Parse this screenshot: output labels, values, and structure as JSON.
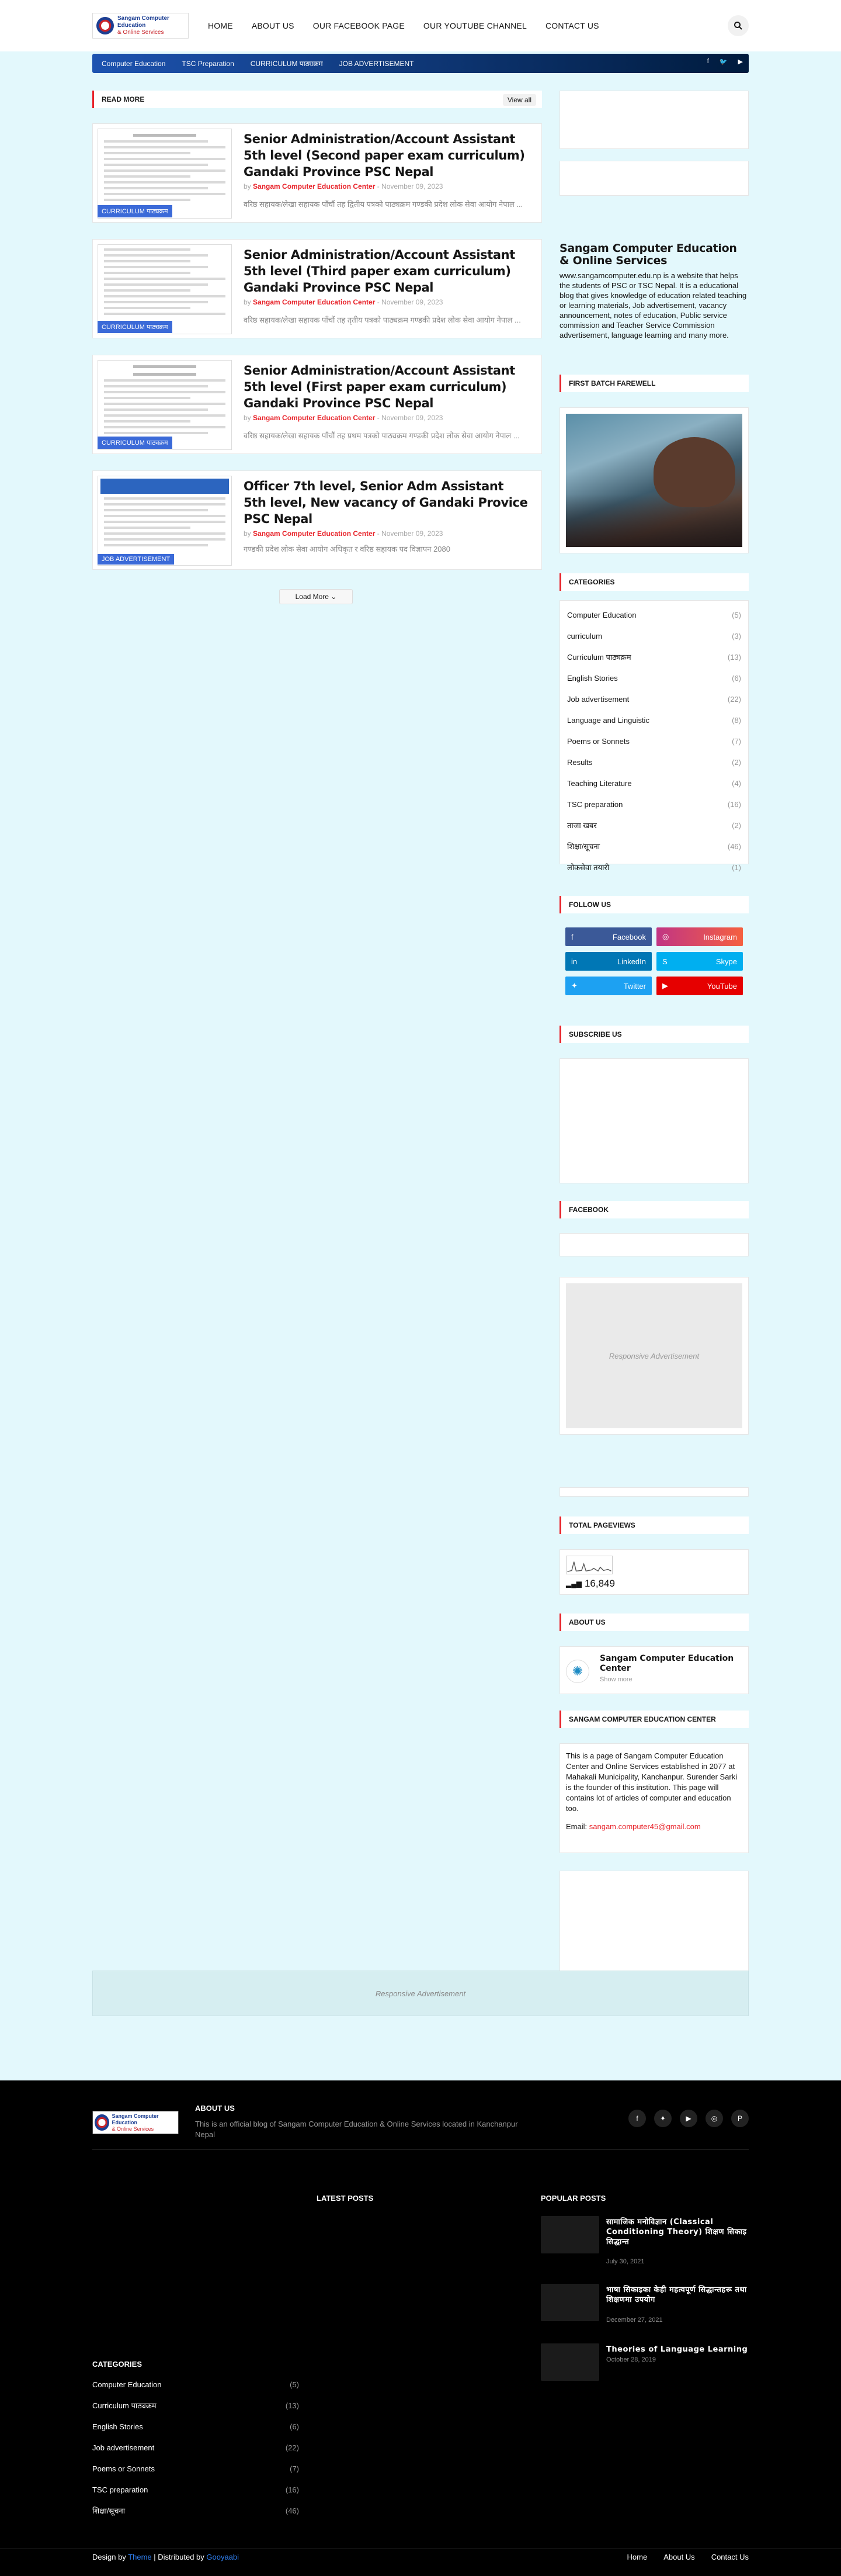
{
  "header": {
    "logo_title": "Sangam Computer Education",
    "logo_sub": "& Online Services",
    "nav": [
      "HOME",
      "ABOUT US",
      "OUR FACEBOOK PAGE",
      "OUR YOUTUBE CHANNEL",
      "CONTACT US"
    ],
    "search_icon": "search-icon"
  },
  "subbar": {
    "items": [
      "Computer Education",
      "TSC Preparation",
      "CURRICULUM पाठ्यक्रम",
      "JOB ADVERTISEMENT"
    ],
    "social_icons": [
      "facebook-icon",
      "twitter-icon",
      "youtube-icon"
    ]
  },
  "main": {
    "section_title": "READ MORE",
    "view_all": "View all",
    "posts": [
      {
        "tag": "CURRICULUM पाठ्यक्रम",
        "title": "Senior Administration/Account Assistant 5th level (Second paper exam curriculum) Gandaki Province PSC Nepal",
        "author": "Sangam Computer Education Center",
        "date": "November 09, 2023",
        "snippet": "वरिष्ठ सहायक/लेखा सहायक पाँचौं तह द्वितीय पत्रको पाठ्यक्रम गण्डकी प्रदेश लोक सेवा आयोग नेपाल ..."
      },
      {
        "tag": "CURRICULUM पाठ्यक्रम",
        "title": "Senior Administration/Account Assistant 5th level (Third paper exam curriculum) Gandaki Province PSC Nepal",
        "author": "Sangam Computer Education Center",
        "date": "November 09, 2023",
        "snippet": "वरिष्ठ सहायक/लेखा सहायक पाँचौं तह तृतीय पत्रको पाठ्यक्रम गण्डकी प्रदेश लोक सेवा आयोग नेपाल ..."
      },
      {
        "tag": "CURRICULUM पाठ्यक्रम",
        "title": "Senior Administration/Account Assistant 5th level (First paper exam curriculum) Gandaki Province PSC Nepal",
        "author": "Sangam Computer Education Center",
        "date": "November 09, 2023",
        "snippet": "वरिष्ठ सहायक/लेखा सहायक पाँचौं तह प्रथम पत्रको पाठ्यक्रम गण्डकी प्रदेश लोक सेवा आयोग नेपाल ..."
      },
      {
        "tag": "JOB ADVERTISEMENT",
        "title": "Officer 7th level, Senior Adm Assistant 5th level, New vacancy of Gandaki Provice PSC Nepal",
        "author": "Sangam Computer Education Center",
        "date": "November 09, 2023",
        "snippet": "गण्डकी प्रदेश लोक सेवा आयोग अधिकृत र वरिष्ठ सहायक पद विज्ञापन  2080"
      }
    ],
    "load_more": "Load More"
  },
  "sidebar": {
    "about_title": "Sangam Computer Education & Online Services",
    "about_text": "www.sangamcomputer.edu.np is a website that helps the students of PSC or TSC Nepal. It is a educational blog that gives knowledge of education related teaching or learning materials, Job advertisement, vacancy announcement, notes of education, Public service commission and Teacher Service Commission advertisement, language learning and many more.",
    "farewell_title": "FIRST BATCH FAREWELL",
    "categories_title": "CATEGORIES",
    "categories": [
      {
        "name": "Computer Education",
        "count": "(5)"
      },
      {
        "name": "curriculum",
        "count": "(3)"
      },
      {
        "name": "Curriculum पाठ्यक्रम",
        "count": "(13)"
      },
      {
        "name": "English Stories",
        "count": "(6)"
      },
      {
        "name": "Job advertisement",
        "count": "(22)"
      },
      {
        "name": "Language and Linguistic",
        "count": "(8)"
      },
      {
        "name": "Poems or Sonnets",
        "count": "(7)"
      },
      {
        "name": "Results",
        "count": "(2)"
      },
      {
        "name": "Teaching Literature",
        "count": "(4)"
      },
      {
        "name": "TSC preparation",
        "count": "(16)"
      },
      {
        "name": "ताजा खबर",
        "count": "(2)"
      },
      {
        "name": "शिक्षा/सूचना",
        "count": "(46)"
      },
      {
        "name": "लोकसेवा तयारी",
        "count": "(1)"
      }
    ],
    "follow_title": "FOLLOW US",
    "follow": [
      {
        "label": "Facebook",
        "icon": "facebook-icon",
        "color": "#3b5998"
      },
      {
        "label": "Instagram",
        "icon": "instagram-icon",
        "color": "#c13584"
      },
      {
        "label": "LinkedIn",
        "icon": "linkedin-icon",
        "color": "#0077b5"
      },
      {
        "label": "Skype",
        "icon": "skype-icon",
        "color": "#00aff0"
      },
      {
        "label": "Twitter",
        "icon": "twitter-icon",
        "color": "#1da1f2"
      },
      {
        "label": "YouTube",
        "icon": "youtube-icon",
        "color": "#e60000"
      }
    ],
    "subscribe_title": "SUBSCRIBE US",
    "facebook_title": "FACEBOOK",
    "responsive_ad": "Responsive Advertisement",
    "pageviews_title": "TOTAL PAGEVIEWS",
    "pageviews": "16,849",
    "aboutus_title": "ABOUT US",
    "profile_name": "Sangam Computer Education Center",
    "profile_link": "Show more",
    "center_title": "SANGAM COMPUTER EDUCATION CENTER",
    "center_text": "This is a page of Sangam Computer Education Center and Online Services established in 2077 at Mahakali Municipality, Kanchanpur. Surender Sarki is the founder of this institution. This page will contains lot of articles of computer and education too.",
    "email_label": "Email:",
    "email": "sangam.computer45@gmail.com"
  },
  "bottom_ad": "Responsive Advertisement",
  "footer": {
    "logo_title": "Sangam Computer Education",
    "logo_sub": "& Online Services",
    "about_title": "ABOUT US",
    "about_text": "This is an official blog of Sangam Computer Education & Online Services located in Kanchanpur Nepal",
    "social_icons": [
      "facebook-icon",
      "twitter-icon",
      "youtube-icon",
      "instagram-icon",
      "pinterest-icon"
    ],
    "latest_title": "LATEST POSTS",
    "popular_title": "POPULAR POSTS",
    "popular": [
      {
        "title": "सामाजिक मनोविज्ञान (Classical Conditioning Theory) शिक्षण सिकाइ सिद्धान्त",
        "date": "July 30, 2021"
      },
      {
        "title": "भाषा सिकाइका केही महत्वपूर्ण सिद्धान्तहरू तथा शिक्षणमा उपयोग",
        "date": "December 27, 2021"
      },
      {
        "title": "Theories of Language Learning",
        "date": "October 28, 2019"
      }
    ],
    "categories_title": "CATEGORIES",
    "categories": [
      {
        "name": "Computer Education",
        "count": "(5)"
      },
      {
        "name": "Curriculum पाठ्यक्रम",
        "count": "(13)"
      },
      {
        "name": "English Stories",
        "count": "(6)"
      },
      {
        "name": "Job advertisement",
        "count": "(22)"
      },
      {
        "name": "Poems or Sonnets",
        "count": "(7)"
      },
      {
        "name": "TSC preparation",
        "count": "(16)"
      },
      {
        "name": "शिक्षा/सूचना",
        "count": "(46)"
      }
    ],
    "credit_design": "Design by",
    "credit_theme": "Theme",
    "credit_dist": "| Distributed by",
    "credit_gooyaabi": "Gooyaabi",
    "links": [
      "Home",
      "About Us",
      "Contact Us"
    ]
  }
}
